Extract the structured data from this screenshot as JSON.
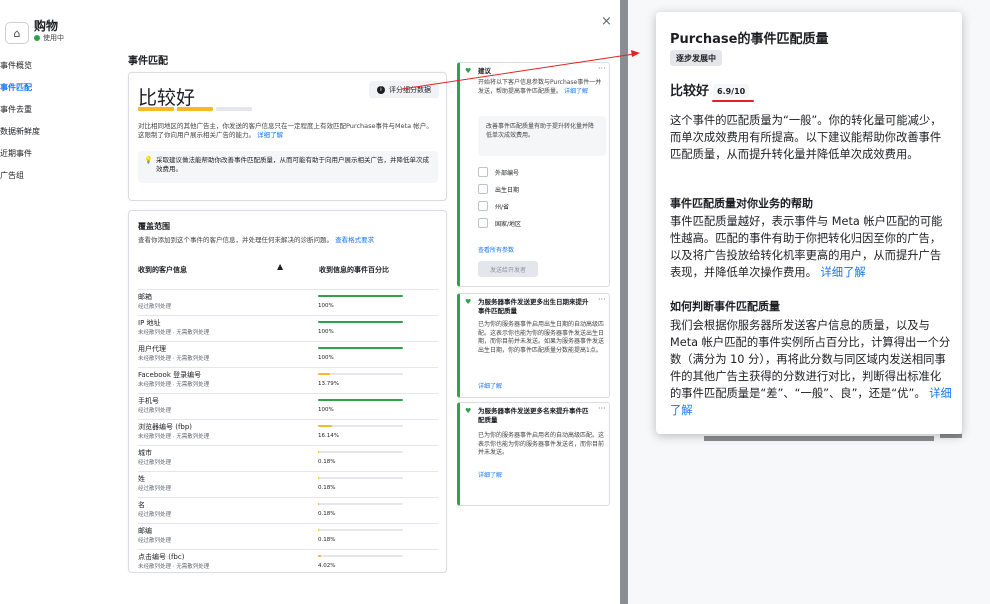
{
  "header": {
    "icon": "home-icon",
    "title": "购物",
    "status": "使用中",
    "close": "×"
  },
  "sidebar": {
    "items": [
      {
        "label": "事件概览",
        "active": false
      },
      {
        "label": "事件匹配",
        "active": true
      },
      {
        "label": "事件去重",
        "active": false
      },
      {
        "label": "数据新鲜度",
        "active": false
      },
      {
        "label": "近期事件",
        "active": false
      },
      {
        "label": "广告组",
        "active": false
      }
    ]
  },
  "main": {
    "section_title": "事件匹配",
    "score_word": "比较好",
    "score_button": "评分细分数据",
    "score_progress_colors": [
      "#f7b928",
      "#f7b928",
      "#e4e6eb"
    ],
    "description": "对比相同地区的其他广告主，你发送的客户信息只在一定程度上有效匹配Purchase事件与Meta 帐户。这限制了你向用户展示相关广告的能力。",
    "description_link": "详细了解",
    "tip": "采取建议做法能帮助你改善事件匹配质量，从而可能有助于向用户展示相关广告，并降低单次成效费用。",
    "coverage": {
      "title": "覆盖范围",
      "subtitle": "查看你添加到这个事件的客户信息，并处理任何未解决的诊断问题。",
      "subtitle_link": "查看格式要求",
      "col1": "收到的客户信息",
      "col2": "收到信息的事件百分比",
      "rows": [
        {
          "name": "邮箱",
          "sub": "经过散列处理",
          "pct": "100%",
          "value": 100,
          "color": "#31a24c"
        },
        {
          "name": "IP 地址",
          "sub": "未经散列处理 · 无需散列处理",
          "pct": "100%",
          "value": 100,
          "color": "#31a24c"
        },
        {
          "name": "用户代理",
          "sub": "未经散列处理 · 无需散列处理",
          "pct": "100%",
          "value": 100,
          "color": "#31a24c"
        },
        {
          "name": "Facebook 登录编号",
          "sub": "未经散列处理 · 无需散列处理",
          "pct": "13.79%",
          "value": 13.79,
          "color": "#f7b928"
        },
        {
          "name": "手机号",
          "sub": "经过散列处理",
          "pct": "100%",
          "value": 100,
          "color": "#31a24c"
        },
        {
          "name": "浏览器编号 (fbp)",
          "sub": "未经散列处理 · 无需散列处理",
          "pct": "16.14%",
          "value": 16.14,
          "color": "#f7b928"
        },
        {
          "name": "城市",
          "sub": "经过散列处理",
          "pct": "0.18%",
          "value": 0.18,
          "color": "#f7b928"
        },
        {
          "name": "姓",
          "sub": "经过散列处理",
          "pct": "0.18%",
          "value": 0.18,
          "color": "#f7b928"
        },
        {
          "name": "名",
          "sub": "经过散列处理",
          "pct": "0.18%",
          "value": 0.18,
          "color": "#f7b928"
        },
        {
          "name": "邮编",
          "sub": "经过散列处理",
          "pct": "0.18%",
          "value": 0.18,
          "color": "#f7b928"
        },
        {
          "name": "点击编号 (fbc)",
          "sub": "未经散列处理 · 无需散列处理",
          "pct": "4.02%",
          "value": 4.02,
          "color": "#f7b928"
        }
      ]
    }
  },
  "recs": [
    {
      "title": "建议",
      "body": "开始将以下客户信息参数与Purchase事件一并发送，帮助提高事件匹配质量。",
      "link": "详细了解",
      "grey": "改善事件匹配质量有助于提升转化量并降低单次成效费用。",
      "checks": [
        "外部编号",
        "出生日期",
        "州/省",
        "国家/地区"
      ],
      "view_all": "查看所有参数",
      "button": "发送给开发者"
    },
    {
      "title": "为服务器事件发送更多出生日期来提升事件匹配质量",
      "body": "已为你的服务器事件启用出生日期的自动高级匹配。这表示你也能为你的服务器事件发送出生日期，而你目前并未发送。如果为服务器事件发送出生日期，你的事件匹配质量分数能提高1点。",
      "link": "详细了解"
    },
    {
      "title": "为服务器事件发送更多名来提升事件匹配质量",
      "body": "已为你的服务器事件启用名的自动高级匹配。这表示你也能为你的服务器事件发送名，而你目前并未发送。",
      "link": "详细了解"
    }
  ],
  "popup": {
    "title": "Purchase的事件匹配质量",
    "badge": "逐步发展中",
    "score_word": "比较好",
    "score_value": "6.9/10",
    "p1": "这个事件的匹配质量为“一般”。你的转化量可能减少，而单次成效费用有所提高。以下建议能帮助你改善事件匹配质量，从而提升转化量并降低单次成效费用。",
    "h1": "事件匹配质量对你业务的帮助",
    "p2": "事件匹配质量越好，表示事件与 Meta 帐户匹配的可能性越高。匹配的事件有助于你把转化归因至你的广告，以及将广告投放给转化机率更高的用户，从而提升广告表现，并降低单次操作费用。",
    "p2_link": "详细了解",
    "h2": "如何判断事件匹配质量",
    "p3": "我们会根据你服务器所发送客户信息的质量，以及与 Meta 帐户匹配的事件实例所占百分比，计算得出一个分数（满分为 10 分），再将此分数与同区域内发送相同事件的其他广告主获得的分数进行对比，判断得出标准化的事件匹配质量是“差”、“一般”、良”，还是“优”。",
    "p3_link": "详细了解"
  }
}
